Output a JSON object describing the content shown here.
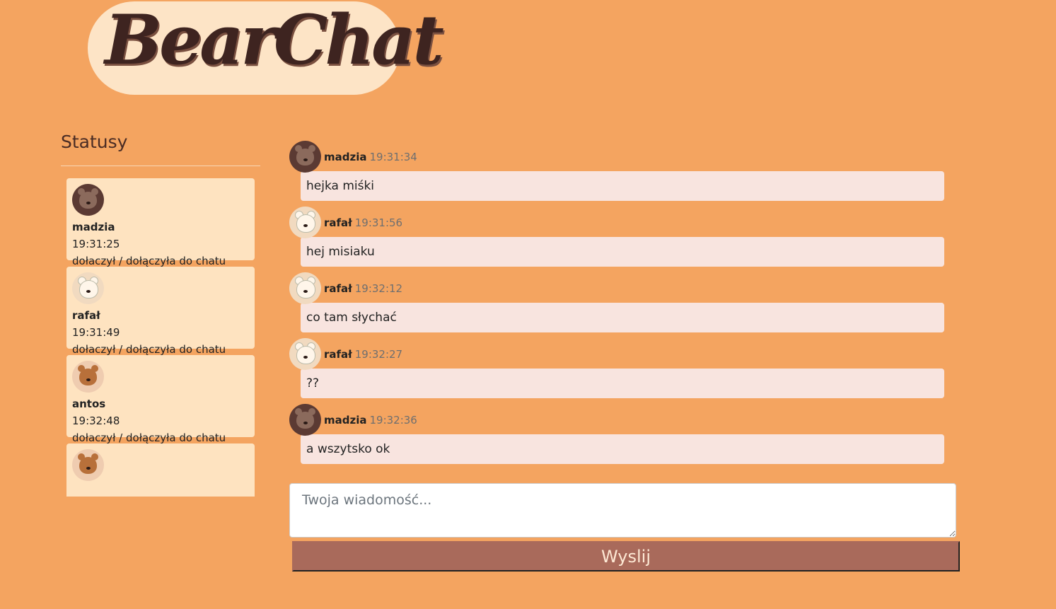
{
  "header": {
    "logo_text": "BearChat"
  },
  "sidebar": {
    "title": "Statusy",
    "statuses": [
      {
        "avatar": "brown-bear-avatar",
        "name": "madzia",
        "time": "19:31:25",
        "text": "dołaczył / dołączyła do chatu"
      },
      {
        "avatar": "white-bear-avatar",
        "name": "rafał",
        "time": "19:31:49",
        "text": "dołaczył / dołączyła do chatu"
      },
      {
        "avatar": "teddy-bear-avatar",
        "name": "antos",
        "time": "19:32:48",
        "text": "dołaczył / dołączyła do chatu"
      }
    ]
  },
  "chat": {
    "messages": [
      {
        "avatar": "brown-bear-avatar",
        "author": "madzia",
        "time": "19:31:34",
        "text": "hejka miśki"
      },
      {
        "avatar": "white-bear-avatar",
        "author": "rafał",
        "time": "19:31:56",
        "text": "hej misiaku"
      },
      {
        "avatar": "white-bear-avatar",
        "author": "rafał",
        "time": "19:32:12",
        "text": "co tam słychać"
      },
      {
        "avatar": "white-bear-avatar",
        "author": "rafał",
        "time": "19:32:27",
        "text": "??"
      },
      {
        "avatar": "brown-bear-avatar",
        "author": "madzia",
        "time": "19:32:36",
        "text": "a wszytsko ok"
      }
    ]
  },
  "composer": {
    "placeholder": "Twoja wiadomość...",
    "value": "",
    "send_label": "Wyslij"
  },
  "colors": {
    "background": "#f4a460",
    "card": "#fee3c0",
    "bubble": "#f8e4df",
    "button": "#a96a5b",
    "logo_text": "#3e2420"
  }
}
